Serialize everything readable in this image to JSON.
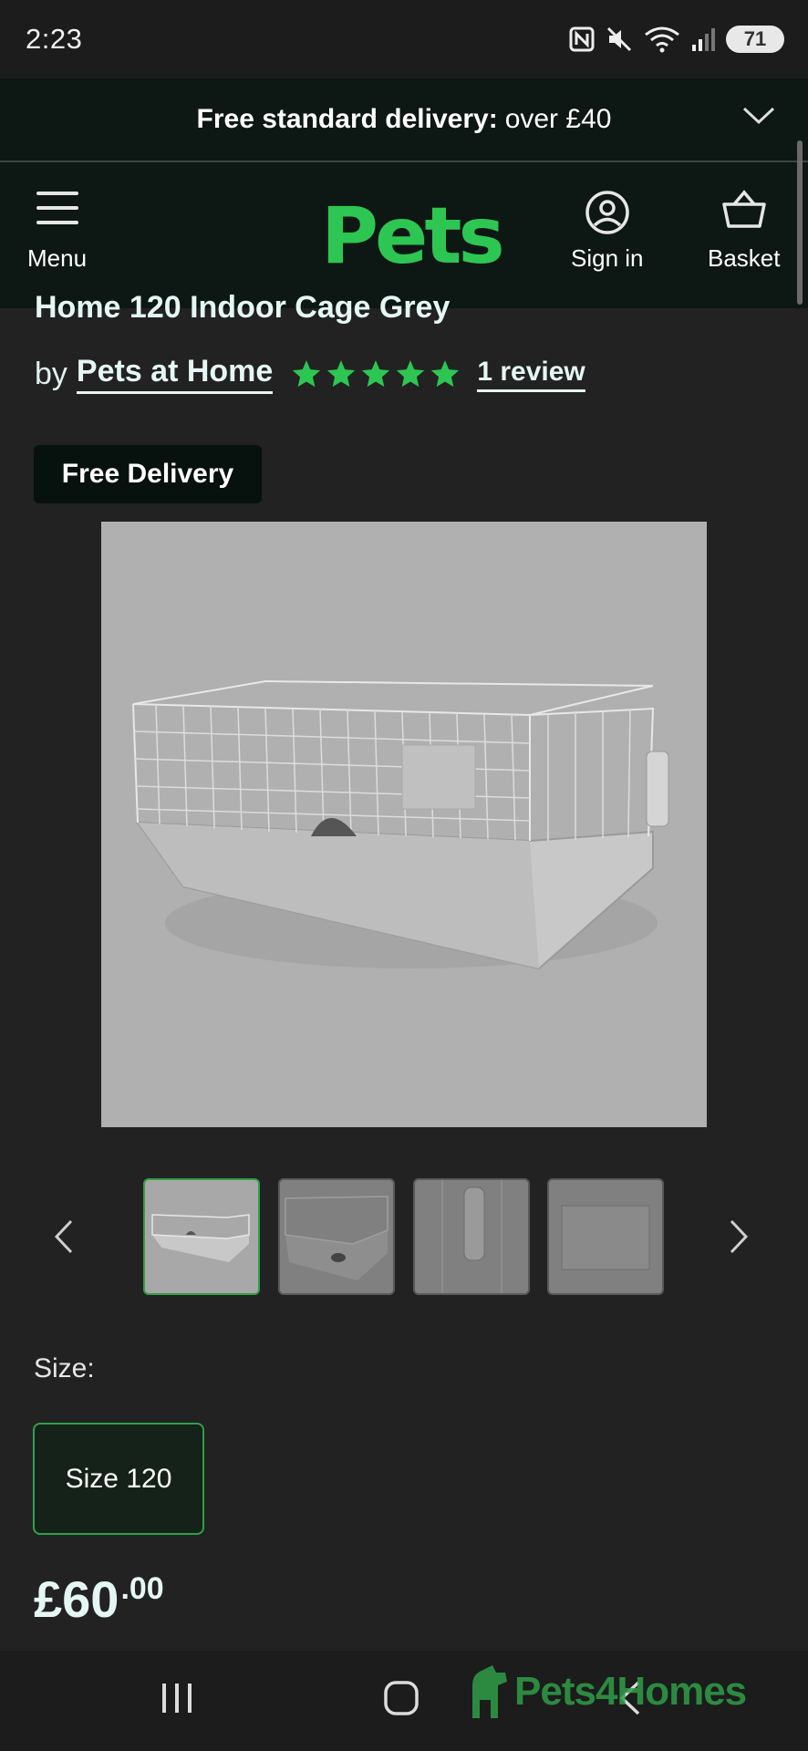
{
  "status_bar": {
    "time": "2:23",
    "battery": "71"
  },
  "banner": {
    "bold": "Free standard delivery:",
    "rest": "over £40"
  },
  "header": {
    "logo": "Pets",
    "menu_label": "Menu",
    "signin_label": "Sign in",
    "basket_label": "Basket"
  },
  "product": {
    "title": "Home 120 Indoor Cage Grey",
    "by": "by",
    "brand": "Pets at Home",
    "rating": 5,
    "review_link": "1 review",
    "badge": "Free Delivery"
  },
  "size": {
    "label": "Size:",
    "option": "Size 120"
  },
  "price": {
    "main": "£60",
    "decimal": ".00"
  },
  "watermark": "Pets4Homes",
  "colors": {
    "brand_green": "#2dc653",
    "header_bg": "#0d1713",
    "page_bg": "#222222",
    "accent_text": "#e5f7f4"
  }
}
